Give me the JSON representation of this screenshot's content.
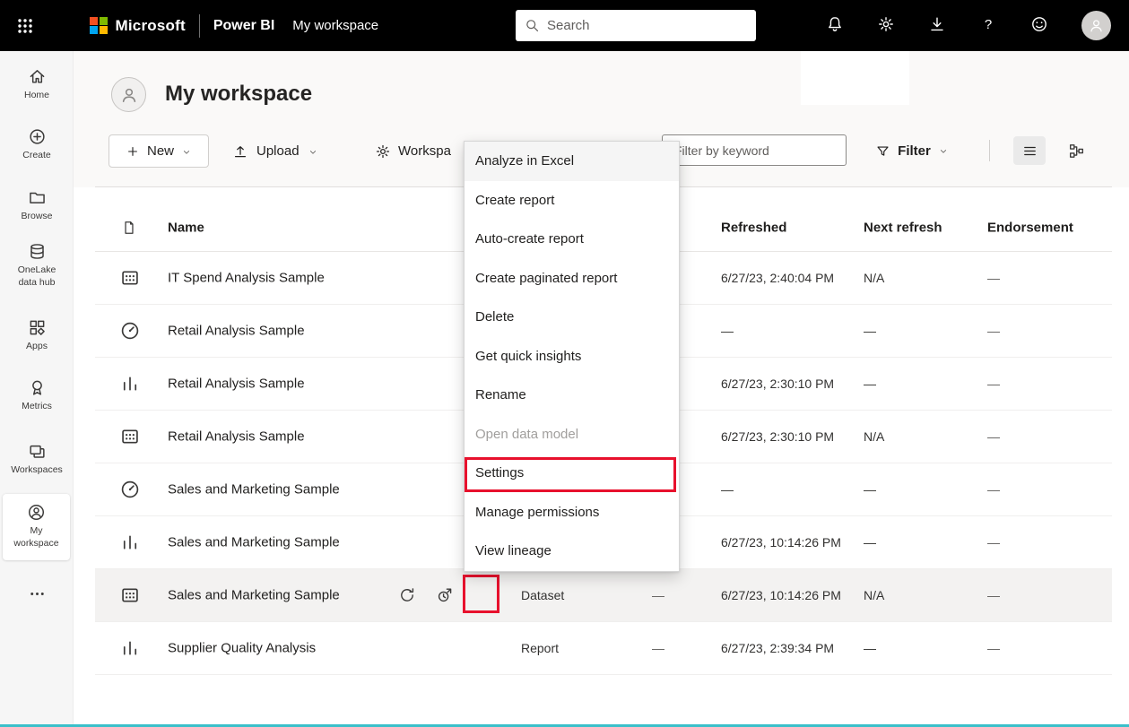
{
  "topbar": {
    "microsoft": "Microsoft",
    "product": "Power BI",
    "workspace": "My workspace",
    "search_placeholder": "Search"
  },
  "sidebar": {
    "items": [
      {
        "id": "home",
        "label": "Home",
        "icon": "home",
        "selected": false
      },
      {
        "id": "create",
        "label": "Create",
        "icon": "plus-circle",
        "selected": false
      },
      {
        "id": "browse",
        "label": "Browse",
        "icon": "folder",
        "selected": false
      },
      {
        "id": "onelake-data-hub",
        "label": "OneLake\ndata hub",
        "icon": "database",
        "selected": false
      },
      {
        "id": "apps",
        "label": "Apps",
        "icon": "apps",
        "selected": false
      },
      {
        "id": "metrics",
        "label": "Metrics",
        "icon": "metrics",
        "selected": false
      },
      {
        "id": "workspaces",
        "label": "Workspaces",
        "icon": "workspaces",
        "selected": false
      },
      {
        "id": "my-workspace",
        "label": "My\nworkspace",
        "icon": "person-circle",
        "selected": true
      },
      {
        "id": "more",
        "label": "",
        "icon": "more-h",
        "selected": false
      }
    ]
  },
  "page": {
    "title": "My workspace"
  },
  "toolbar": {
    "new_label": "New",
    "upload_label": "Upload",
    "workspace_settings_label": "Workspa",
    "filter_placeholder": "Filter by keyword",
    "filter_label": "Filter"
  },
  "table": {
    "headers": {
      "name": "Name",
      "refreshed": "Refreshed",
      "next_refresh": "Next refresh",
      "endorsement": "Endorsement"
    },
    "rows": [
      {
        "icon": "dataset",
        "name": "IT Spend Analysis Sample",
        "type": "",
        "col4": "",
        "refreshed": "6/27/23, 2:40:04 PM",
        "next_refresh": "N/A",
        "endorsement": "—",
        "hovered": false
      },
      {
        "icon": "dashboard",
        "name": "Retail Analysis Sample",
        "type": "",
        "col4": "",
        "refreshed": "—",
        "next_refresh": "—",
        "endorsement": "—",
        "hovered": false
      },
      {
        "icon": "report",
        "name": "Retail Analysis Sample",
        "type": "",
        "col4": "",
        "refreshed": "6/27/23, 2:30:10 PM",
        "next_refresh": "—",
        "endorsement": "—",
        "hovered": false
      },
      {
        "icon": "dataset",
        "name": "Retail Analysis Sample",
        "type": "",
        "col4": "",
        "refreshed": "6/27/23, 2:30:10 PM",
        "next_refresh": "N/A",
        "endorsement": "—",
        "hovered": false
      },
      {
        "icon": "dashboard",
        "name": "Sales and Marketing Sample",
        "type": "",
        "col4": "",
        "refreshed": "—",
        "next_refresh": "—",
        "endorsement": "—",
        "hovered": false
      },
      {
        "icon": "report",
        "name": "Sales and Marketing Sample",
        "type": "",
        "col4": "",
        "refreshed": "6/27/23, 10:14:26 PM",
        "next_refresh": "—",
        "endorsement": "—",
        "hovered": false
      },
      {
        "icon": "dataset",
        "name": "Sales and Marketing Sample",
        "type": "Dataset",
        "col4": "—",
        "refreshed": "6/27/23, 10:14:26 PM",
        "next_refresh": "N/A",
        "endorsement": "—",
        "hovered": true,
        "actions": [
          "refresh",
          "scheduled-refresh",
          "more"
        ]
      },
      {
        "icon": "report",
        "name": "Supplier Quality Analysis",
        "type": "Report",
        "col4": "—",
        "refreshed": "6/27/23, 2:39:34 PM",
        "next_refresh": "—",
        "endorsement": "—",
        "hovered": false
      }
    ]
  },
  "context_menu": {
    "items": [
      {
        "label": "Analyze in Excel",
        "state": "hover"
      },
      {
        "label": "Create report",
        "state": "normal"
      },
      {
        "label": "Auto-create report",
        "state": "normal"
      },
      {
        "label": "Create paginated report",
        "state": "normal"
      },
      {
        "label": "Delete",
        "state": "normal"
      },
      {
        "label": "Get quick insights",
        "state": "normal"
      },
      {
        "label": "Rename",
        "state": "normal"
      },
      {
        "label": "Open data model",
        "state": "disabled"
      },
      {
        "label": "Settings",
        "state": "annotated"
      },
      {
        "label": "Manage permissions",
        "state": "normal"
      },
      {
        "label": "View lineage",
        "state": "normal"
      }
    ]
  },
  "annotations": {
    "color": "#e8112d"
  },
  "colors": {
    "topbar_bg": "#000000",
    "accent_bottom": "#3ac0ca",
    "ms_red": "#f25022",
    "ms_green": "#7fba00",
    "ms_blue": "#00a4ef",
    "ms_yellow": "#ffb900"
  }
}
